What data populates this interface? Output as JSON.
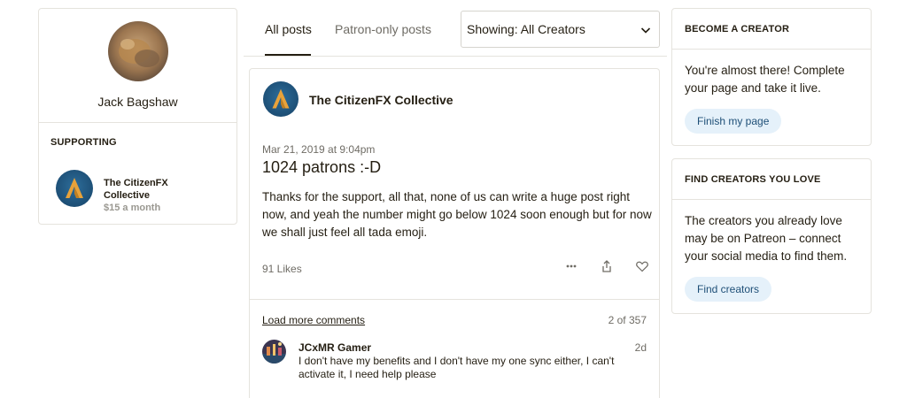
{
  "profile": {
    "name": "Jack Bagshaw",
    "supporting_title": "SUPPORTING",
    "supported_creator": "The CitizenFX Collective",
    "price": "$15 a month"
  },
  "tabs": {
    "all_posts": "All posts",
    "patron_only": "Patron-only posts",
    "filter_selected": "Showing: All Creators"
  },
  "post": {
    "creator": "The CitizenFX Collective",
    "date": "Mar 21, 2019 at 9:04pm",
    "title": "1024 patrons :-D",
    "body": "Thanks for the support, all that, none of us can write a huge post right now, and yeah the number might go below 1024 soon enough but for now we shall just feel all tada emoji.",
    "likes": "91 Likes",
    "load_more": "Load more comments",
    "comment_count": "2 of 357",
    "comment": {
      "author": "JCxMR Gamer",
      "time": "2d",
      "text": "I don't have my benefits and I don't have my one sync either, I can't activate it, I need help please"
    }
  },
  "become_creator": {
    "title": "BECOME A CREATOR",
    "text": "You're almost there! Complete your page and take it live.",
    "button": "Finish my page"
  },
  "find_creators": {
    "title": "FIND CREATORS YOU LOVE",
    "text": "The creators you already love may be on Patreon – connect your social media to find them.",
    "button": "Find creators"
  },
  "colors": {
    "text": "#241e12",
    "muted": "#6f6c65",
    "border": "#e5e3dd",
    "pill_bg": "#e5f1fa",
    "pill_text": "#1e4f77",
    "logo_blue": "#1d4f76",
    "logo_orange": "#e8a23a"
  },
  "icons": {
    "more": "more-horizontal-icon",
    "share": "share-icon",
    "like": "heart-icon",
    "dropdown": "chevron-down-icon"
  }
}
